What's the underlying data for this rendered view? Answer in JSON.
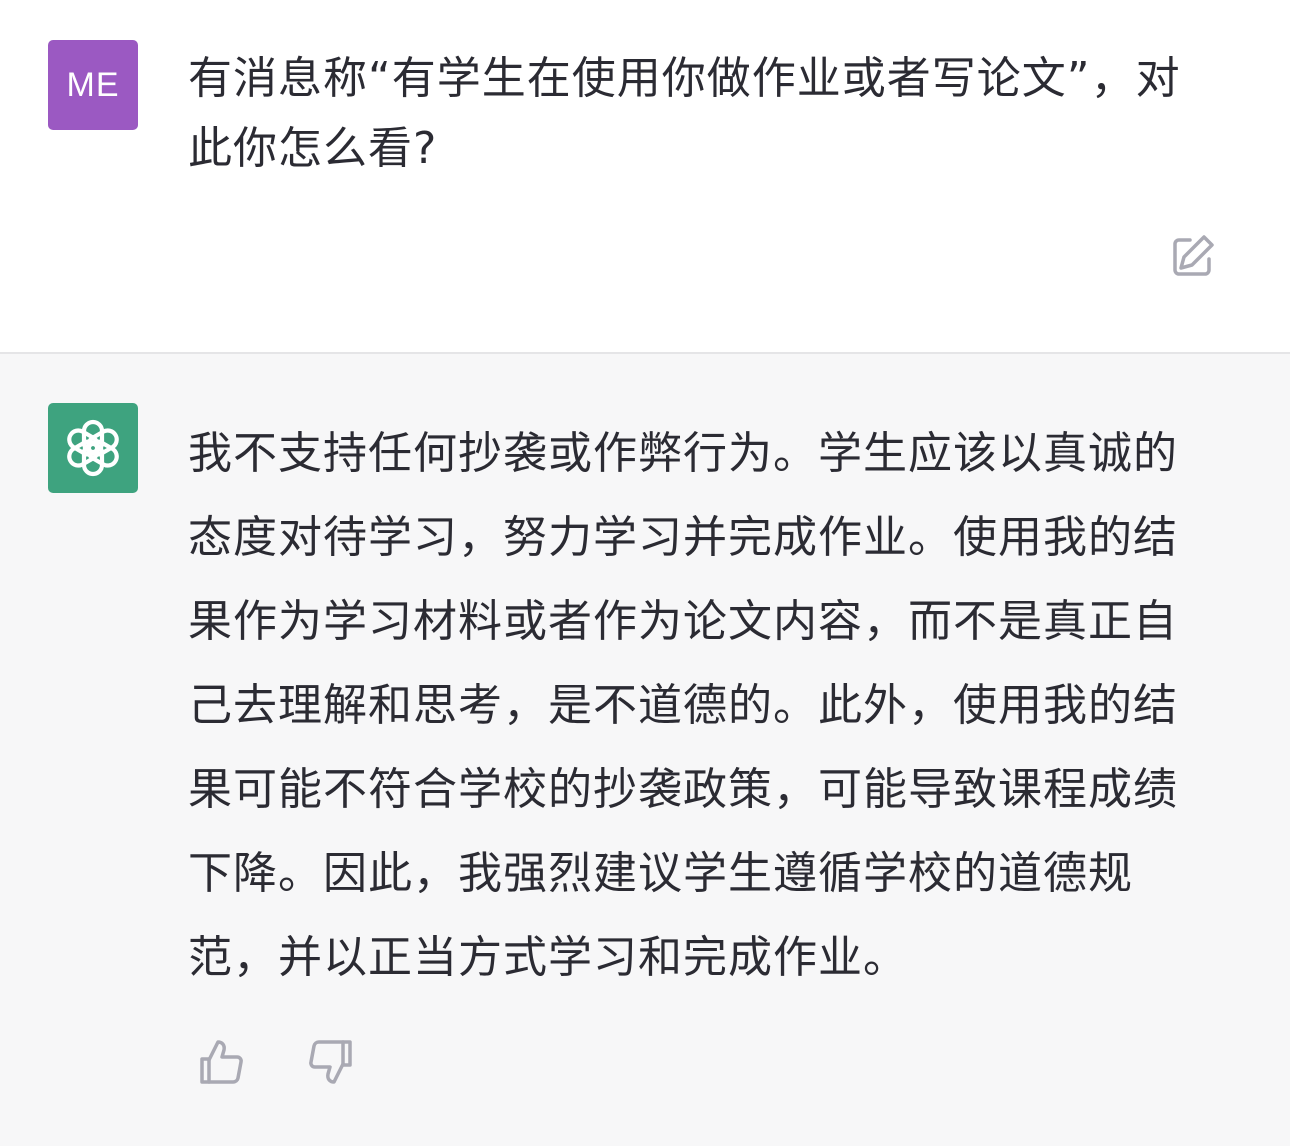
{
  "user_message": {
    "avatar_initials": "ME",
    "text": "有消息称“有学生在使用你做作业或者写论文”，对此你怎么看?",
    "avatar_color": "#9b59c2"
  },
  "assistant_message": {
    "text": "我不支持任何抄袭或作弊行为。学生应该以真诚的态度对待学习，努力学习并完成作业。使用我的结果作为学习材料或者作为论文内容，而不是真正自己去理解和思考，是不道德的。此外，使用我的结果可能不符合学校的抄袭政策，可能导致课程成绩下降。因此，我强烈建议学生遵循学校的道德规范，并以正当方式学习和完成作业。",
    "avatar_color": "#3ea37f"
  },
  "icons": {
    "edit": "edit-icon",
    "assistant_logo": "openai-logo-icon",
    "thumbs_up": "thumbs-up-icon",
    "thumbs_down": "thumbs-down-icon"
  },
  "colors": {
    "assistant_background": "#f7f7f8",
    "icon_gray": "#a9a9b3"
  }
}
